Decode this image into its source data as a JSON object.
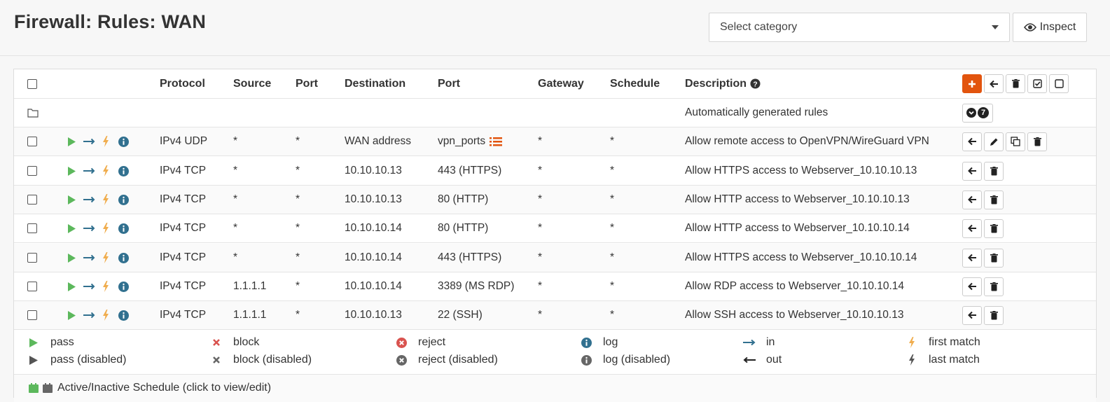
{
  "page": {
    "title": "Firewall: Rules: WAN"
  },
  "toolbar": {
    "category_placeholder": "Select category",
    "inspect_label": "Inspect"
  },
  "table": {
    "headers": {
      "protocol": "Protocol",
      "source": "Source",
      "src_port": "Port",
      "destination": "Destination",
      "dst_port": "Port",
      "gateway": "Gateway",
      "schedule": "Schedule",
      "description": "Description"
    },
    "auto_rules": {
      "label": "Automatically generated rules",
      "count": "7"
    },
    "rules": [
      {
        "protocol": "IPv4 UDP",
        "source": "*",
        "src_port": "*",
        "destination": "WAN address",
        "dst_port": "vpn_ports",
        "gateway": "*",
        "schedule": "*",
        "description": "Allow remote access to OpenVPN/WireGuard VPN"
      },
      {
        "protocol": "IPv4 TCP",
        "source": "*",
        "src_port": "*",
        "destination": "10.10.10.13",
        "dst_port": "443 (HTTPS)",
        "gateway": "*",
        "schedule": "*",
        "description": "Allow HTTPS access to Webserver_10.10.10.13"
      },
      {
        "protocol": "IPv4 TCP",
        "source": "*",
        "src_port": "*",
        "destination": "10.10.10.13",
        "dst_port": "80 (HTTP)",
        "gateway": "*",
        "schedule": "*",
        "description": "Allow HTTP access to Webserver_10.10.10.13"
      },
      {
        "protocol": "IPv4 TCP",
        "source": "*",
        "src_port": "*",
        "destination": "10.10.10.14",
        "dst_port": "80 (HTTP)",
        "gateway": "*",
        "schedule": "*",
        "description": "Allow HTTP access to Webserver_10.10.10.14"
      },
      {
        "protocol": "IPv4 TCP",
        "source": "*",
        "src_port": "*",
        "destination": "10.10.10.14",
        "dst_port": "443 (HTTPS)",
        "gateway": "*",
        "schedule": "*",
        "description": "Allow HTTPS access to Webserver_10.10.10.14"
      },
      {
        "protocol": "IPv4 TCP",
        "source": "1.1.1.1",
        "src_port": "*",
        "destination": "10.10.10.14",
        "dst_port": "3389 (MS RDP)",
        "gateway": "*",
        "schedule": "*",
        "description": "Allow RDP access to Webserver_10.10.10.14"
      },
      {
        "protocol": "IPv4 TCP",
        "source": "1.1.1.1",
        "src_port": "*",
        "destination": "10.10.10.13",
        "dst_port": "22 (SSH)",
        "gateway": "*",
        "schedule": "*",
        "description": "Allow SSH access to Webserver_10.10.10.13"
      }
    ]
  },
  "legend": {
    "pass": "pass",
    "pass_disabled": "pass (disabled)",
    "block": "block",
    "block_disabled": "block (disabled)",
    "reject": "reject",
    "reject_disabled": "reject (disabled)",
    "log": "log",
    "log_disabled": "log (disabled)",
    "in": "in",
    "out": "out",
    "first_match": "first match",
    "last_match": "last match"
  },
  "footer": {
    "schedule_note": "Active/Inactive Schedule (click to view/edit)"
  },
  "colors": {
    "accent": "#e2540e",
    "pass": "#5cb85c",
    "direction": "#31708f",
    "match": "#f0ad4e",
    "info": "#31708f",
    "block": "#d9534f"
  }
}
